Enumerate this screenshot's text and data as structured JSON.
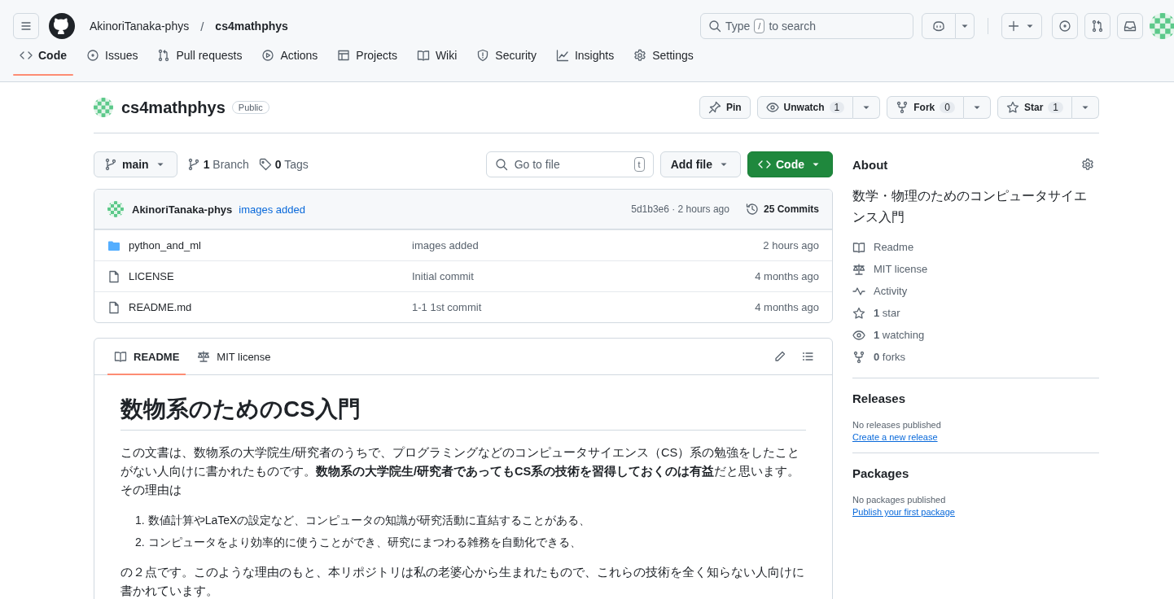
{
  "header": {
    "owner": "AkinoriTanaka-phys",
    "separator": "/",
    "repo": "cs4mathphys",
    "search": {
      "before": "Type",
      "key": "/",
      "after": "to search"
    }
  },
  "nav_tabs": [
    {
      "kind": "code",
      "label": "Code",
      "selected": true
    },
    {
      "kind": "issue",
      "label": "Issues",
      "selected": false
    },
    {
      "kind": "pr",
      "label": "Pull requests",
      "selected": false
    },
    {
      "kind": "play",
      "label": "Actions",
      "selected": false
    },
    {
      "kind": "table",
      "label": "Projects",
      "selected": false
    },
    {
      "kind": "book",
      "label": "Wiki",
      "selected": false
    },
    {
      "kind": "shield",
      "label": "Security",
      "selected": false
    },
    {
      "kind": "graph",
      "label": "Insights",
      "selected": false
    },
    {
      "kind": "gear",
      "label": "Settings",
      "selected": false
    }
  ],
  "repo": {
    "name": "cs4mathphys",
    "visibility": "Public",
    "pin": "Pin",
    "unwatch": {
      "label": "Unwatch",
      "count": "1"
    },
    "fork": {
      "label": "Fork",
      "count": "0"
    },
    "star": {
      "label": "Star",
      "count": "1"
    }
  },
  "toolbar": {
    "branch": "main",
    "branches": "**1** Branch",
    "tags": "**0** Tags",
    "go_to_file": {
      "placeholder": "Go to file",
      "key": "t"
    },
    "add_file": "Add file",
    "code": "Code"
  },
  "latest_commit": {
    "author": "AkinoriTanaka-phys",
    "message": "images added",
    "hash_time": "5d1b3e6 · 2 hours ago",
    "commits": "25 Commits"
  },
  "files": [
    {
      "kind": "folder",
      "name": "python_and_ml",
      "message": "images added",
      "time": "2 hours ago"
    },
    {
      "kind": "file",
      "name": "LICENSE",
      "message": "Initial commit",
      "time": "4 months ago"
    },
    {
      "kind": "file",
      "name": "README.md",
      "message": "1-1 1st commit",
      "time": "4 months ago"
    }
  ],
  "readme": {
    "tabs": [
      {
        "kind": "book",
        "label": "README",
        "selected": true
      },
      {
        "kind": "scale",
        "label": "MIT license",
        "selected": false
      }
    ],
    "title": "数物系のためのCS入門",
    "intro": "この文書は、数物系の大学院生/研究者のうちで、プログラミングなどのコンピュータサイエンス（CS）系の勉強をしたことがない人向けに書かれたものです。**数物系の大学院生/研究者であってもCS系の技術を習得しておくのは有益**だと思います。その理由は",
    "list": [
      {
        "number": "1.",
        "text": "数値計算やLaTeXの設定など、コンピュータの知識が研究活動に直結することがある、"
      },
      {
        "number": "2.",
        "text": "コンピュータをより効率的に使うことができ、研究にまつわる雑務を自動化できる、"
      }
    ],
    "outro": "の２点です。このような理由のもと、本リポジトリは私の老婆心から生まれたもので、これらの技術を全く知らない人向けに書かれています。"
  },
  "about": {
    "title": "About",
    "description": "数学・物理のためのコンピュータサイエンス入門",
    "items": [
      {
        "kind": "book",
        "label": "Readme"
      },
      {
        "kind": "scale",
        "label": "MIT license"
      },
      {
        "kind": "pulse",
        "label": "Activity"
      },
      {
        "kind": "star",
        "label": "**1** star"
      },
      {
        "kind": "eye",
        "label": "**1** watching"
      },
      {
        "kind": "fork",
        "label": "**0** forks"
      }
    ]
  },
  "releases": {
    "title": "Releases",
    "note": "No releases published",
    "link": "Create a new release"
  },
  "packages": {
    "title": "Packages",
    "note": "No packages published",
    "link": "Publish your first package"
  }
}
